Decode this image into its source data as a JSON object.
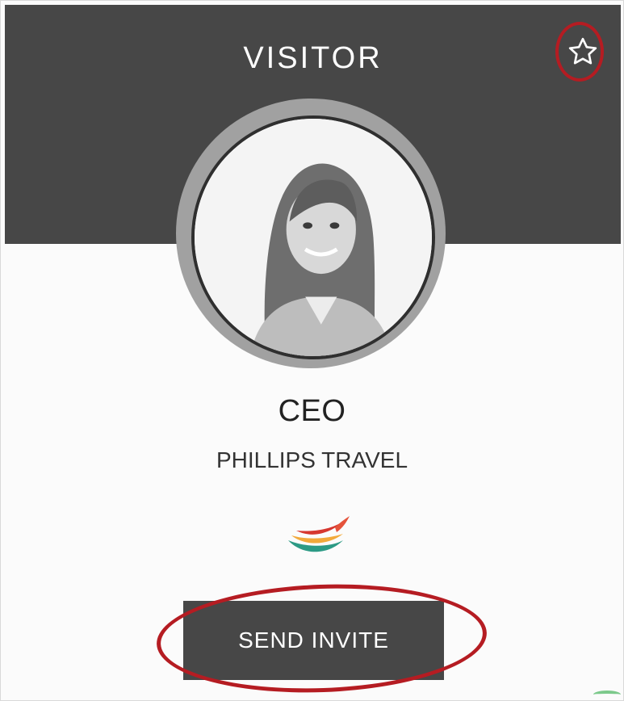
{
  "header": {
    "title": "VISITOR",
    "favorite_icon": "star-outline-icon"
  },
  "profile": {
    "avatar_alt": "visitor-photo",
    "role": "CEO",
    "company": "PHILLIPS TRAVEL",
    "company_logo_icon": "company-logo"
  },
  "actions": {
    "send_invite_label": "SEND INVITE"
  },
  "colors": {
    "header_bg": "#474747",
    "button_bg": "#474747",
    "highlight_ring": "#b51c22",
    "avatar_ring": "#a1a1a1"
  }
}
